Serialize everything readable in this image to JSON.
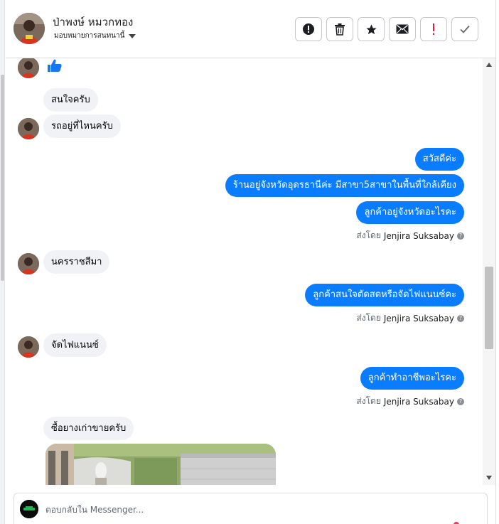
{
  "header": {
    "name": "ป่าพงษ์ หมวกทอง",
    "assign_label": "มอบหมายการสนทนานี้"
  },
  "toolbar": [
    {
      "name": "report-spam-button",
      "icon": "exclamation-circle-icon"
    },
    {
      "name": "delete-button",
      "icon": "trash-icon"
    },
    {
      "name": "star-button",
      "icon": "star-icon"
    },
    {
      "name": "mark-unread-button",
      "icon": "envelope-icon"
    },
    {
      "name": "follow-up-button",
      "icon": "exclamation-icon"
    },
    {
      "name": "mark-done-button",
      "icon": "checkmark-icon"
    }
  ],
  "messages": {
    "m1": "สนใจครับ",
    "m2": "รถอยู่ที่ไหนครับ",
    "m3": "สวัสดีค่ะ",
    "m4": "ร้านอยู่จังหวัดอุดรธานีค่ะ มีสาขา5สาขาในพื้นที่ใกล้เคียง",
    "m5": "ลูกค้าอยู่จังหวัดอะไรคะ",
    "m6": "นครราชสีมา",
    "m7": "ลูกค้าสนใจตัดสดหรือจัดไฟแนนซ์คะ",
    "m8": "จัดไฟแนนซ์",
    "m9": "ลูกค้าทำอาชีพอะไรคะ",
    "m10": "ซื้อยางเก่าขายครับ"
  },
  "sent_by": {
    "prefix": "ส่งโดย",
    "agent": "Jenjira Suksabay",
    "info_symbol": "?"
  },
  "composer": {
    "placeholder": "ตอบกลับใน Messenger..."
  },
  "colors": {
    "outgoing_bubble": "#0a7cff",
    "incoming_bubble": "#f0f2f5",
    "like_icon": "#1877f2"
  }
}
